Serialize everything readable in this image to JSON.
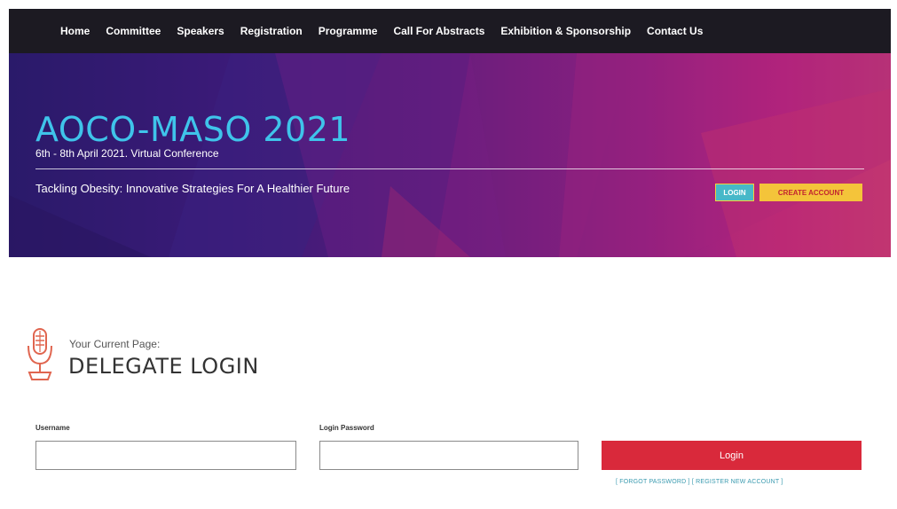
{
  "nav": {
    "items": [
      {
        "label": "Home"
      },
      {
        "label": "Committee"
      },
      {
        "label": "Speakers"
      },
      {
        "label": "Registration"
      },
      {
        "label": "Programme"
      },
      {
        "label": "Call For Abstracts"
      },
      {
        "label": "Exhibition & Sponsorship"
      },
      {
        "label": "Contact Us"
      }
    ]
  },
  "hero": {
    "title": "AOCO-MASO 2021",
    "dates": "6th - 8th April 2021. Virtual Conference",
    "tagline": "Tackling Obesity: Innovative Strategies For A Healthier Future",
    "login_label": "LOGIN",
    "create_account_label": "CREATE ACCOUNT"
  },
  "page": {
    "current_label": "Your Current Page:",
    "title": "DELEGATE LOGIN"
  },
  "form": {
    "username_label": "Username",
    "username_value": "",
    "password_label": "Login Password",
    "password_value": "",
    "submit_label": "Login",
    "forgot_password": "[ FORGOT PASSWORD ]",
    "register": "[ REGISTER NEW ACCOUNT ]"
  },
  "colors": {
    "nav_bg": "#1c1a22",
    "title_accent": "#3fc4ea",
    "login_button": "#47b8c8",
    "create_button": "#f4c43a",
    "submit_button": "#d9293b",
    "mic_icon": "#e0654f",
    "link": "#3b9bb0"
  },
  "icons": {
    "page_icon": "microphone-icon"
  }
}
